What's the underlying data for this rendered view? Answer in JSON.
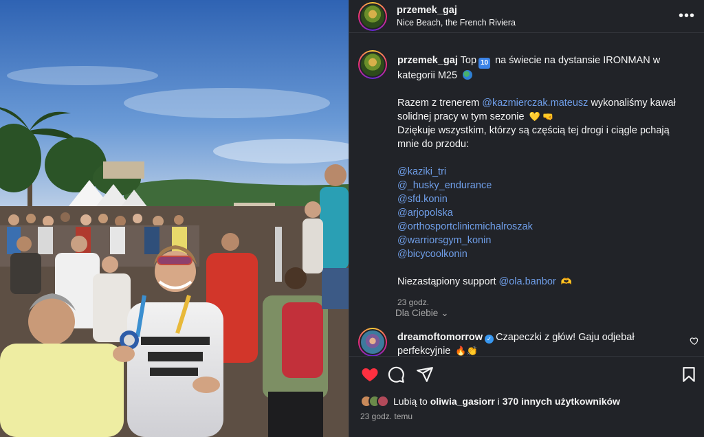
{
  "post": {
    "username": "przemek_gaj",
    "location": "Nice Beach, the French Riviera",
    "more_icon": "more-horizontal-icon"
  },
  "caption": {
    "username": "przemek_gaj",
    "line1_pre": "Top",
    "badge": "10",
    "line1_post": "na świecie na dystansie IRONMAN w kategorii M25",
    "p2_pre": "Razem z trenerem",
    "coach_mention": "@kazmierczak.mateusz",
    "p2_post": "wykonaliśmy kawał solidnej pracy w tym sezonie",
    "p2_emojis": "💛 🤜",
    "p3": "Dziękuje wszystkim, którzy są częścią tej drogi i ciągle pchają mnie do przodu:",
    "mentions": [
      "@kaziki_tri",
      "@_husky_endurance",
      "@sfd.konin",
      "@arjopolska",
      "@orthosportclinicmichalroszak",
      "@warriorsgym_konin",
      "@bicycoolkonin"
    ],
    "support_pre": "Niezastąpiony support",
    "support_mention": "@ola.banbor",
    "support_emoji": "🫶",
    "time": "23 godz."
  },
  "for_you": {
    "label": "Dla Ciebie",
    "icon": "chevron-down-icon"
  },
  "comment": {
    "username": "dreamoftomorrow",
    "verified_icon": "verified-badge-icon",
    "text_line1": "Czapeczki z głów! Gaju odjebał",
    "text_line2": "perfekcyjnie",
    "emojis": "🔥👏"
  },
  "actions": {
    "like_icon": "heart-filled-icon",
    "comment_icon": "comment-icon",
    "share_icon": "share-icon",
    "save_icon": "bookmark-icon",
    "like_color": "#ff3040"
  },
  "likes": {
    "pre": "Lubią to",
    "user": "oliwia_gasiorr",
    "mid": "i",
    "count": "370 innych użytkowników"
  },
  "timestamp": "23 godz. temu"
}
